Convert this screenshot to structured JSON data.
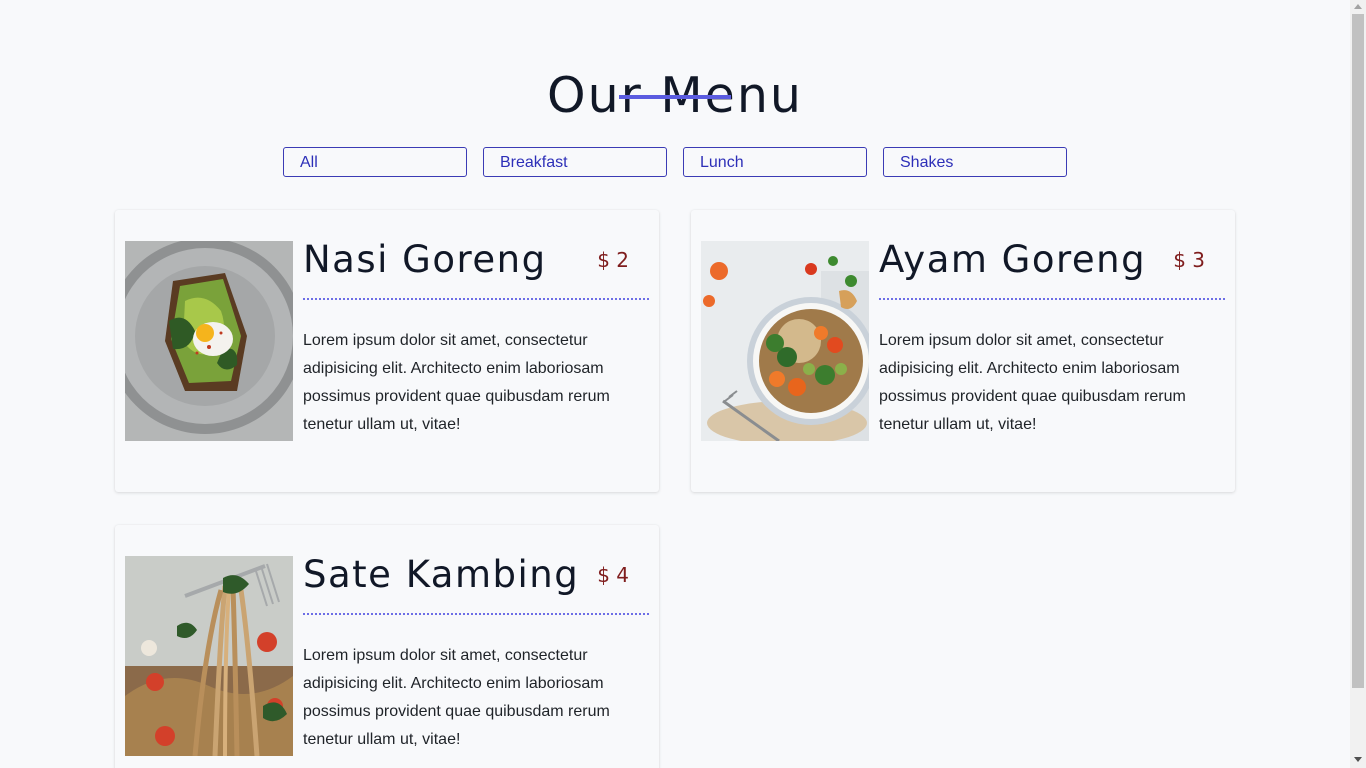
{
  "page": {
    "title": "Our Menu"
  },
  "filters": [
    {
      "label": "All"
    },
    {
      "label": "Breakfast"
    },
    {
      "label": "Lunch"
    },
    {
      "label": "Shakes"
    }
  ],
  "menu_items": [
    {
      "name": "Nasi Goreng",
      "price": "$ 2",
      "description": "Lorem ipsum dolor sit amet, consectetur adipisicing elit. Architecto enim laboriosam possimus provident quae quibusdam rerum tenetur ullam ut, vitae!"
    },
    {
      "name": "Ayam Goreng",
      "price": "$ 3",
      "description": "Lorem ipsum dolor sit amet, consectetur adipisicing elit. Architecto enim laboriosam possimus provident quae quibusdam rerum tenetur ullam ut, vitae!"
    },
    {
      "name": "Sate Kambing",
      "price": "$ 4",
      "description": "Lorem ipsum dolor sit amet, consectetur adipisicing elit. Architecto enim laboriosam possimus provident quae quibusdam rerum tenetur ullam ut, vitae!"
    }
  ],
  "colors": {
    "accent": "#5b5ce0",
    "button_border": "#3b3bb5",
    "price": "#7f1d1d",
    "background": "#f8f9fb"
  }
}
